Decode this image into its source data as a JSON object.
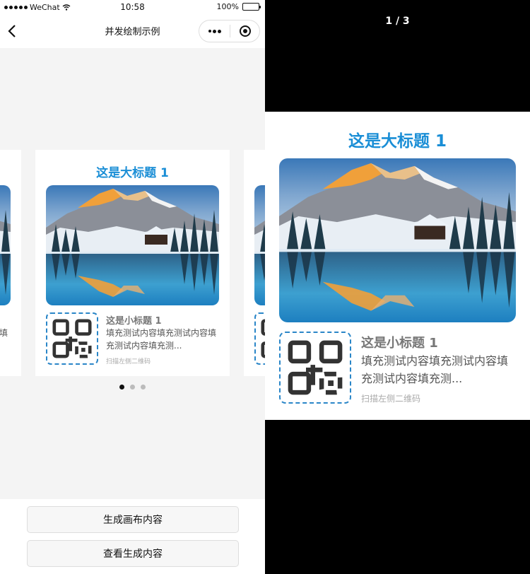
{
  "status_bar": {
    "carrier": "WeChat",
    "time": "10:58",
    "battery": "100%"
  },
  "nav": {
    "title": "并发绘制示例",
    "back_icon": "chevron-left-icon"
  },
  "card": {
    "big_title": "这是大标题 1",
    "sub_title": "这是小标题 1",
    "body": "填充测试内容填充测试内容填充测试内容填充测...",
    "hint": "扫描左侧二维码",
    "prev_body": "内…",
    "next_sub": ""
  },
  "indicator": {
    "count": 3,
    "active": 0
  },
  "buttons": {
    "generate": "生成画布内容",
    "view": "查看生成内容"
  },
  "preview": {
    "counter": "1 / 3",
    "big_title": "这是大标题 1",
    "sub_title": "这是小标题 1",
    "body": "填充测试内容填充测试内容填充测试内容填充测...",
    "hint": "扫描左侧二维码"
  },
  "colors": {
    "accent": "#1a8ed6",
    "qr_border": "#2a86c8"
  }
}
